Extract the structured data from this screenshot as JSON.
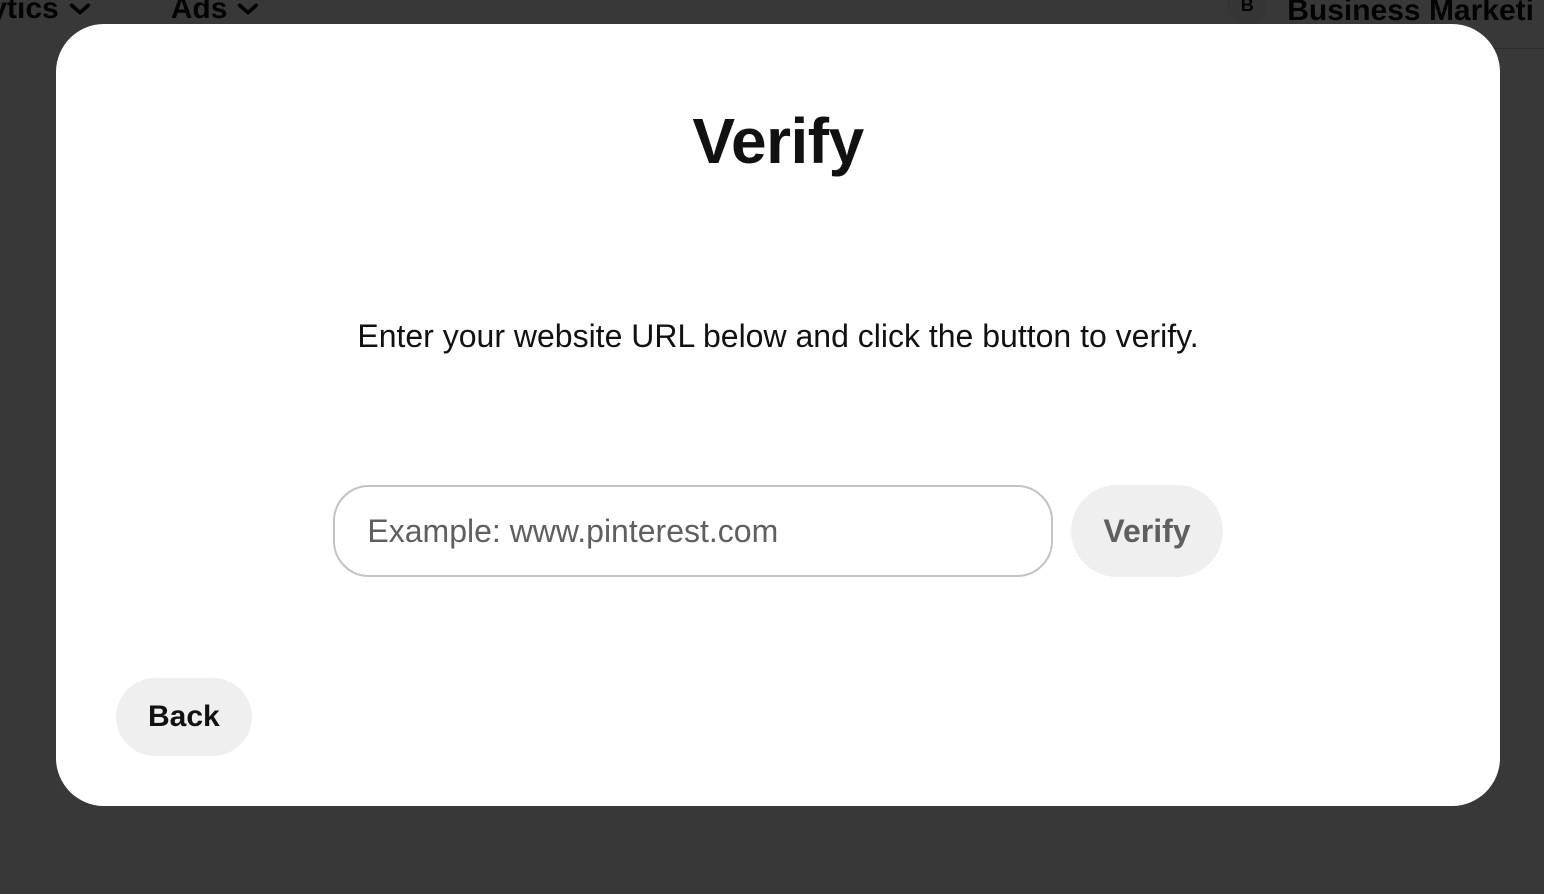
{
  "nav": {
    "items": [
      {
        "label": "lytics"
      },
      {
        "label": "Ads"
      }
    ],
    "avatar_initial": "B",
    "business_label": "Business Marketi"
  },
  "modal": {
    "title": "Verify",
    "subtitle": "Enter your website URL below and click the button to verify.",
    "input_placeholder": "Example: www.pinterest.com",
    "input_value": "",
    "verify_button": "Verify",
    "back_button": "Back"
  }
}
